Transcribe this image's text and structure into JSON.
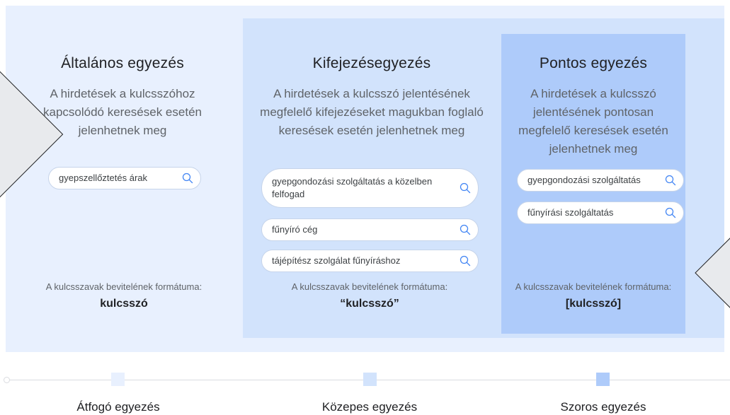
{
  "columns": [
    {
      "title": "Általános egyezés",
      "description": "A hirdetések a kulcsszóhoz kapcsolódó keresések esetén jelenhetnek meg",
      "format_label": "A kulcsszavak bevitelének formátuma:",
      "format_value": "kulcsszó",
      "searches": [
        "gyepszellőztetés árak"
      ]
    },
    {
      "title": "Kifejezésegyezés",
      "description": "A hirdetések a kulcsszó jelentésének megfelelő kifejezéseket magukban foglaló keresések esetén jelenhetnek meg",
      "format_label": "A kulcsszavak bevitelének formátuma:",
      "format_value": "“kulcsszó”",
      "searches": [
        "gyepgondozási szolgáltatás a közelben felfogad",
        "fűnyíró cég",
        "tájépítész szolgálat fűnyíráshoz"
      ]
    },
    {
      "title": "Pontos egyezés",
      "description": "A hirdetések a kulcsszó jelentésének pontosan megfelelő keresések esetén jelenhetnek meg",
      "format_label": "A kulcsszavak bevitelének formátuma:",
      "format_value": "[kulcsszó]",
      "searches": [
        "gyepgondozási szolgáltatás",
        "fűnyírási szolgáltatás"
      ]
    }
  ],
  "timeline": {
    "labels": [
      "Átfogó egyezés",
      "Közepes egyezés",
      "Szoros egyezés"
    ]
  },
  "colors": {
    "panel_light": "#e8f0fe",
    "panel_mid": "#d2e3fc",
    "panel_dark": "#aecbfa",
    "search_icon": "#4285f4"
  }
}
